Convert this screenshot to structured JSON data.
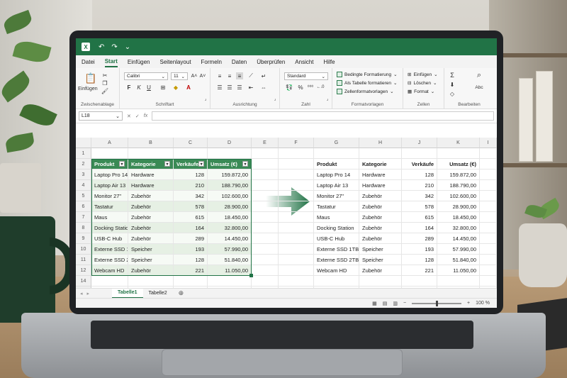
{
  "app": {
    "logo_letter": "X",
    "accent": "#217346",
    "undo_glyph": "↶",
    "redo_glyph": "↷",
    "qa_more_glyph": "⌄"
  },
  "menu_tabs": [
    "Datei",
    "Start",
    "Einfügen",
    "Seitenlayout",
    "Formeln",
    "Daten",
    "Überprüfen",
    "Ansicht",
    "Hilfe"
  ],
  "active_tab_index": 1,
  "ribbon": {
    "clipboard": {
      "paste_label": "Einfügen",
      "group_label": "Zwischenablage"
    },
    "font": {
      "font_name": "Calibri",
      "font_size": "11",
      "bold": "F",
      "italic": "K",
      "underline": "U",
      "group_label": "Schriftart"
    },
    "alignment": {
      "group_label": "Ausrichtung"
    },
    "number": {
      "format": "Standard",
      "group_label": "Zahl"
    },
    "styles": {
      "conditional": "Bedingte Formatierung",
      "as_table": "Als Tabelle formatieren",
      "cell_styles": "Zellenformatvorlagen",
      "group_label": "Formatvorlagen"
    },
    "cells": {
      "insert": "Einfügen",
      "delete": "Löschen",
      "format": "Format",
      "group_label": "Zellen"
    },
    "editing": {
      "sort_label": "Abc",
      "group_label": "Bearbeiten"
    }
  },
  "formula_bar": {
    "name_box": "L18",
    "cancel": "✕",
    "confirm": "✓",
    "fx": "fx"
  },
  "columns": [
    "A",
    "B",
    "C",
    "D",
    "E",
    "F",
    "G",
    "H",
    "J",
    "K",
    "I"
  ],
  "rows": [
    "1",
    "2",
    "3",
    "4",
    "5",
    "6",
    "7",
    "8",
    "9",
    "10",
    "11",
    "12",
    "14",
    "15"
  ],
  "table": {
    "headers": [
      "Produkt",
      "Kategorie",
      "Verkäufe",
      "Umsatz (€)"
    ],
    "rows": [
      [
        "Laptop Pro 14",
        "Hardware",
        "128",
        "159.872,00"
      ],
      [
        "Laptop Air 13",
        "Hardware",
        "210",
        "188.790,00"
      ],
      [
        "Monitor 27\"",
        "Zubehör",
        "342",
        "102.600,00"
      ],
      [
        "Tastatur",
        "Zubehör",
        "578",
        "28.900,00"
      ],
      [
        "Maus",
        "Zubehör",
        "615",
        "18.450,00"
      ],
      [
        "Docking Station",
        "Zubehör",
        "164",
        "32.800,00"
      ],
      [
        "USB-C Hub",
        "Zubehör",
        "289",
        "14.450,00"
      ],
      [
        "Externe SSD 1TB",
        "Speicher",
        "193",
        "57.990,00"
      ],
      [
        "Externe SSD 2TB",
        "Speicher",
        "128",
        "51.840,00"
      ],
      [
        "Webcam HD",
        "Zubehör",
        "221",
        "11.050,00"
      ]
    ]
  },
  "sheets": [
    "Tabelle1",
    "Tabelle2"
  ],
  "active_sheet_index": 0,
  "status": {
    "zoom": "100 %"
  }
}
